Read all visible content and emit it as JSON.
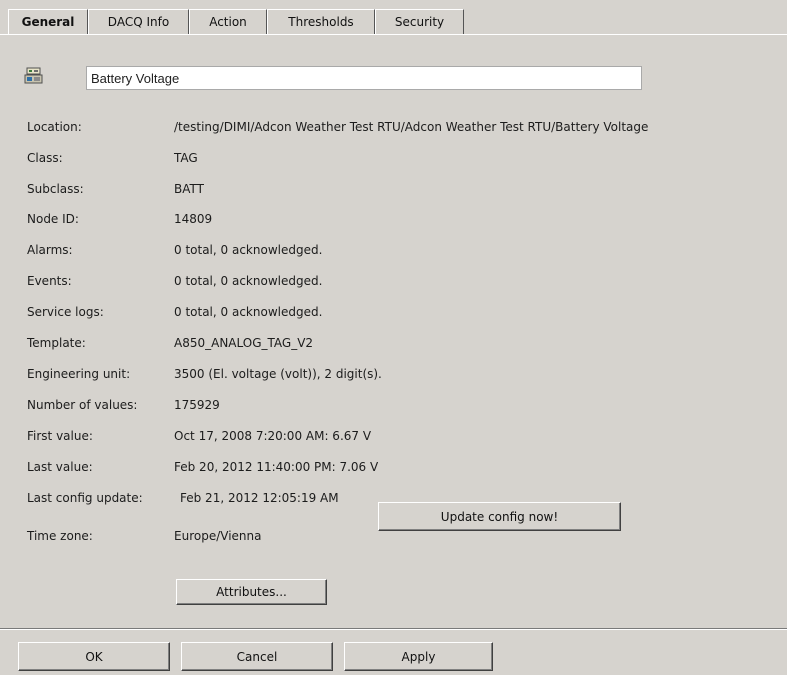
{
  "tabs": [
    {
      "label": "General",
      "active": true
    },
    {
      "label": "DACQ Info",
      "active": false
    },
    {
      "label": "Action",
      "active": false
    },
    {
      "label": "Thresholds",
      "active": false
    },
    {
      "label": "Security",
      "active": false
    }
  ],
  "header": {
    "icon": "tag-object-icon",
    "name_value": "Battery Voltage"
  },
  "fields": {
    "location": {
      "label": "Location:",
      "value": "/testing/DIMI/Adcon Weather Test RTU/Adcon Weather Test RTU/Battery Voltage"
    },
    "class": {
      "label": "Class:",
      "value": "TAG"
    },
    "subclass": {
      "label": "Subclass:",
      "value": "BATT"
    },
    "node_id": {
      "label": "Node ID:",
      "value": "14809"
    },
    "alarms": {
      "label": "Alarms:",
      "value": "0 total, 0 acknowledged."
    },
    "events": {
      "label": "Events:",
      "value": "0 total, 0 acknowledged."
    },
    "service_logs": {
      "label": "Service logs:",
      "value": "0 total, 0 acknowledged."
    },
    "template": {
      "label": "Template:",
      "value": "A850_ANALOG_TAG_V2"
    },
    "engineering_unit": {
      "label": "Engineering unit:",
      "value": "3500 (El. voltage (volt)), 2 digit(s)."
    },
    "number_of_values": {
      "label": "Number of values:",
      "value": "175929"
    },
    "first_value": {
      "label": "First value:",
      "value": "Oct 17, 2008 7:20:00 AM: 6.67 V"
    },
    "last_value": {
      "label": "Last value:",
      "value": "Feb 20, 2012 11:40:00 PM: 7.06 V"
    },
    "last_config_update": {
      "label": "Last config update:",
      "value": "Feb 21, 2012 12:05:19 AM"
    },
    "time_zone": {
      "label": "Time zone:",
      "value": "Europe/Vienna"
    }
  },
  "buttons": {
    "update_config": "Update config now!",
    "attributes": "Attributes...",
    "ok": "OK",
    "cancel": "Cancel",
    "apply": "Apply"
  }
}
